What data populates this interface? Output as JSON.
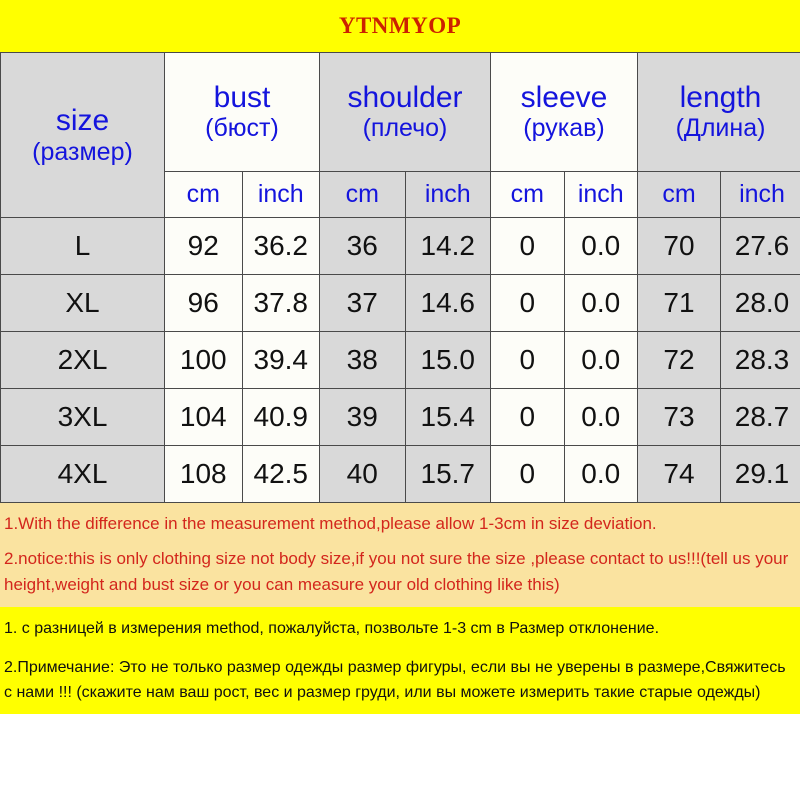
{
  "title": {
    "brand": "YTNMYOP",
    "color": "#cc2200",
    "background": "#ffff00"
  },
  "colors": {
    "header_text": "#1414dd",
    "cell_gray": "#d9d9d9",
    "cell_white": "#fdfdf8",
    "notes_en_bg": "#fae3a0",
    "notes_en_text": "#d3261c",
    "notes_ru_bg": "#ffff00",
    "notes_ru_text": "#101010"
  },
  "table": {
    "size_header": {
      "en": "size",
      "ru": "(размер)"
    },
    "groups": [
      {
        "en": "bust",
        "ru": "(бюст)",
        "shade": "white"
      },
      {
        "en": "shoulder",
        "ru": "(плечо)",
        "shade": "gray"
      },
      {
        "en": "sleeve",
        "ru": "(рукав)",
        "shade": "white"
      },
      {
        "en": "length",
        "ru": "(Длина)",
        "shade": "gray"
      }
    ],
    "units": [
      "cm",
      "inch",
      "cm",
      "inch",
      "cm",
      "inch",
      "cm",
      "inch"
    ],
    "rows": [
      {
        "size": "L",
        "cells": [
          "92",
          "36.2",
          "36",
          "14.2",
          "0",
          "0.0",
          "70",
          "27.6"
        ]
      },
      {
        "size": "XL",
        "cells": [
          "96",
          "37.8",
          "37",
          "14.6",
          "0",
          "0.0",
          "71",
          "28.0"
        ]
      },
      {
        "size": "2XL",
        "cells": [
          "100",
          "39.4",
          "38",
          "15.0",
          "0",
          "0.0",
          "72",
          "28.3"
        ]
      },
      {
        "size": "3XL",
        "cells": [
          "104",
          "40.9",
          "39",
          "15.4",
          "0",
          "0.0",
          "73",
          "28.7"
        ]
      },
      {
        "size": "4XL",
        "cells": [
          "108",
          "42.5",
          "40",
          "15.7",
          "0",
          "0.0",
          "74",
          "29.1"
        ]
      }
    ]
  },
  "notes_en": [
    "1.With the difference in the measurement method,please allow 1-3cm in size deviation.",
    "2.notice:this is only clothing size not body size,if you not sure the size ,please contact to us!!!(tell us your height,weight and bust size or you can measure your old clothing like this)"
  ],
  "notes_ru": [
    "1. с разницей в измерения method, пожалуйста, позвольте 1-3 cm в Размер отклонение.",
    "2.Примечание: Это не только размер одежды размер фигуры, если вы не уверены в размере,Свяжитесь с нами !!! (скажите нам ваш рост, вес и размер груди, или вы можете измерить такие старые одежды)"
  ]
}
